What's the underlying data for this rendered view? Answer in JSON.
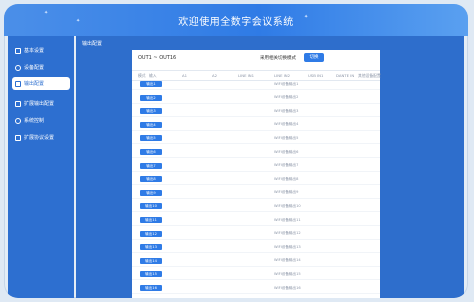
{
  "window": {
    "title": "欢迎使用全数字会议系统"
  },
  "sidebar": {
    "items": [
      {
        "label": "基本设置",
        "icon": "monitor-icon",
        "active": false
      },
      {
        "label": "设备配置",
        "icon": "settings-icon",
        "active": false
      },
      {
        "label": "输出配置",
        "icon": "output-icon",
        "active": true
      },
      {
        "label": "扩展输出配置",
        "icon": "expand-icon",
        "active": false
      },
      {
        "label": "系统控制",
        "icon": "power-icon",
        "active": false
      },
      {
        "label": "扩展协议设置",
        "icon": "protocol-icon",
        "active": false
      }
    ]
  },
  "main": {
    "breadcrumb": "输出配置",
    "panel": {
      "range_label": "OUT1 ~ OUT16",
      "mode_label": "采用相关切换模式",
      "switch_button": "切换",
      "columns": [
        "模式",
        "输入",
        "A1",
        "A2",
        "LINE IN1",
        "LINE IN2",
        "USB IN1",
        "DANTE IN",
        "其他设备配置"
      ],
      "rows": [
        {
          "out": "输出1",
          "wifi": "WIFI设备输出1"
        },
        {
          "out": "输出2",
          "wifi": "WIFI设备输出2"
        },
        {
          "out": "输出3",
          "wifi": "WIFI设备输出3"
        },
        {
          "out": "输出4",
          "wifi": "WIFI设备输出4"
        },
        {
          "out": "输出5",
          "wifi": "WIFI设备输出5"
        },
        {
          "out": "输出6",
          "wifi": "WIFI设备输出6"
        },
        {
          "out": "输出7",
          "wifi": "WIFI设备输出7"
        },
        {
          "out": "输出8",
          "wifi": "WIFI设备输出8"
        },
        {
          "out": "输出9",
          "wifi": "WIFI设备输出9"
        },
        {
          "out": "输出10",
          "wifi": "WIFI设备输出10"
        },
        {
          "out": "输出11",
          "wifi": "WIFI设备输出11"
        },
        {
          "out": "输出12",
          "wifi": "WIFI设备输出12"
        },
        {
          "out": "输出13",
          "wifi": "WIFI设备输出13"
        },
        {
          "out": "输出14",
          "wifi": "WIFI设备输出14"
        },
        {
          "out": "输出15",
          "wifi": "WIFI设备输出15"
        },
        {
          "out": "输出16",
          "wifi": "WIFI设备输出16"
        }
      ]
    }
  }
}
